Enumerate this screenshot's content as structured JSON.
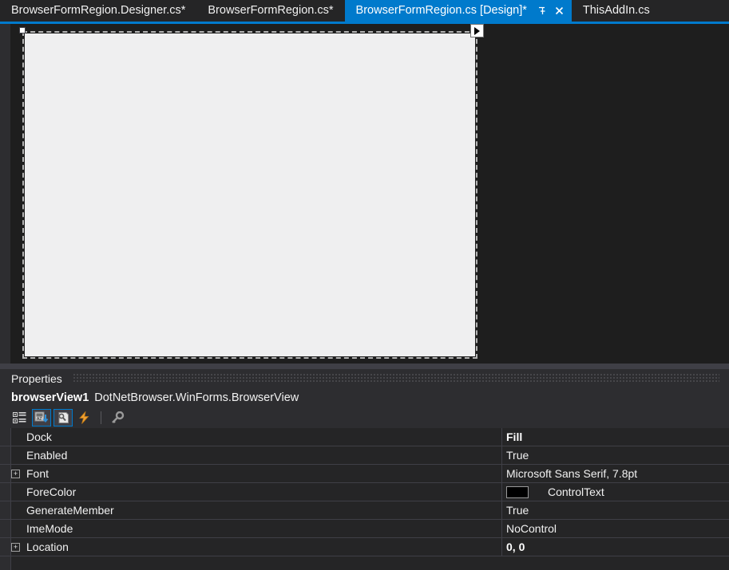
{
  "tabs": [
    {
      "label": "BrowserFormRegion.Designer.cs*",
      "active": false
    },
    {
      "label": "BrowserFormRegion.cs*",
      "active": false
    },
    {
      "label": "BrowserFormRegion.cs [Design]*",
      "active": true
    },
    {
      "label": "ThisAddIn.cs",
      "active": false
    }
  ],
  "tab_icons": {
    "pin": "↲",
    "close": "✕"
  },
  "designer": {
    "smart_tag_glyph": "triangle-right"
  },
  "properties": {
    "title": "Properties",
    "selected_object_name": "browserView1",
    "selected_object_type": "DotNetBrowser.WinForms.BrowserView",
    "toolbar": [
      {
        "name": "categorized-button",
        "checked": false
      },
      {
        "name": "alphabetical-button",
        "checked": true
      },
      {
        "name": "properties-button",
        "checked": true
      },
      {
        "name": "events-button",
        "checked": false
      },
      {
        "name": "property-pages-button",
        "checked": false
      }
    ],
    "rows": [
      {
        "name": "Dock",
        "value": "Fill",
        "bold": true,
        "expandable": false,
        "swatch": null
      },
      {
        "name": "Enabled",
        "value": "True",
        "bold": false,
        "expandable": false,
        "swatch": null
      },
      {
        "name": "Font",
        "value": "Microsoft Sans Serif, 7.8pt",
        "bold": false,
        "expandable": true,
        "swatch": null
      },
      {
        "name": "ForeColor",
        "value": "ControlText",
        "bold": false,
        "expandable": false,
        "swatch": "#000000"
      },
      {
        "name": "GenerateMember",
        "value": "True",
        "bold": false,
        "expandable": false,
        "swatch": null
      },
      {
        "name": "ImeMode",
        "value": "NoControl",
        "bold": false,
        "expandable": false,
        "swatch": null
      },
      {
        "name": "Location",
        "value": "0, 0",
        "bold": true,
        "expandable": true,
        "swatch": null
      }
    ],
    "expander_glyph": "+"
  },
  "colors": {
    "accent": "#007acc",
    "window_bg": "#1e1e1e",
    "panel_bg": "#252526",
    "chrome_bg": "#2d2d30",
    "splitter": "#3f3f46",
    "form_surface": "#efeff0",
    "text": "#f1f1f1"
  }
}
